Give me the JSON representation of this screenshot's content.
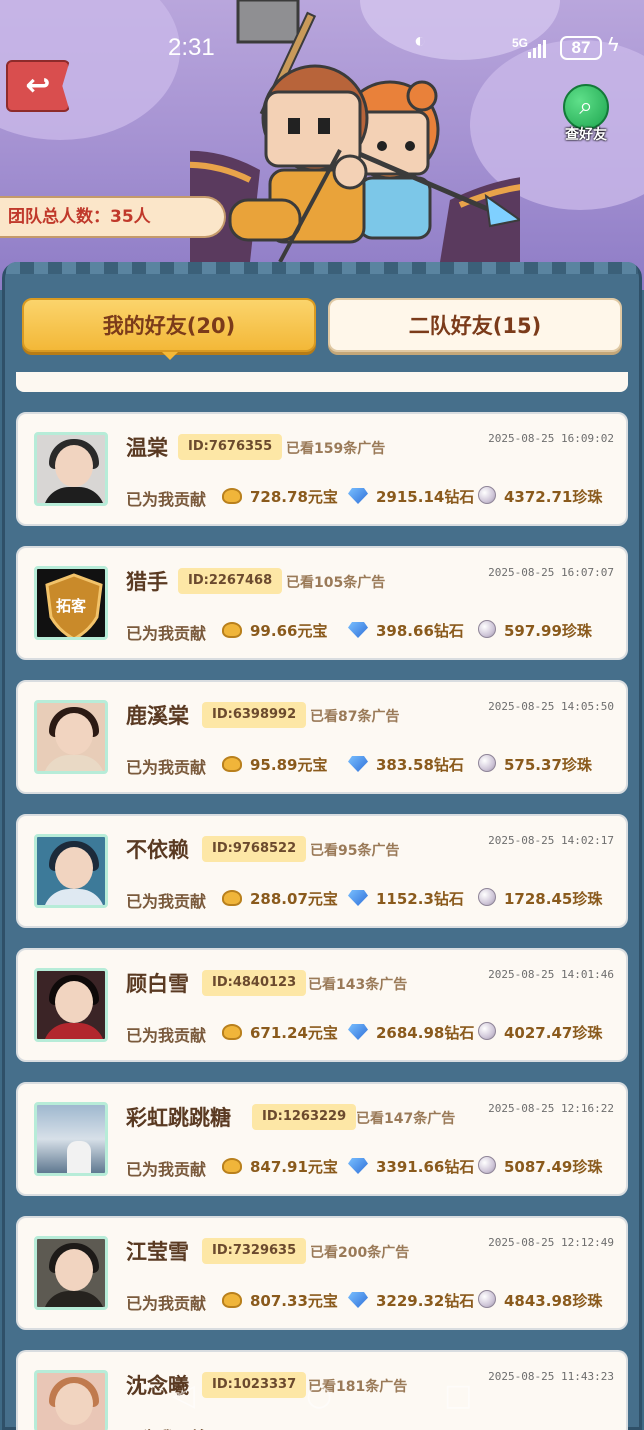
{
  "status_bar": {
    "time": "2:31",
    "network": "5G",
    "battery": "87"
  },
  "header": {
    "back_label": "↩",
    "search_friend_label": "查好友",
    "team_total": "团队总人数：35人"
  },
  "tabs": [
    {
      "label": "我的好友(20)",
      "active": true
    },
    {
      "label": "二队好友(15)",
      "active": false
    }
  ],
  "contrib_label": "已为我贡献",
  "friends": [
    {
      "name": "温棠",
      "id": "ID:7676355",
      "ads": "已看159条广告",
      "date": "2025-08-25 16:09:02",
      "ingot": "728.78元宝",
      "diamond": "2915.14钻石",
      "pearl": "4372.71珍珠"
    },
    {
      "name": "猎手",
      "id": "ID:2267468",
      "ads": "已看105条广告",
      "date": "2025-08-25 16:07:07",
      "ingot": "99.66元宝",
      "diamond": "398.66钻石",
      "pearl": "597.99珍珠",
      "avatar_text": "拓客"
    },
    {
      "name": "鹿溪棠",
      "id": "ID:6398992",
      "ads": "已看87条广告",
      "date": "2025-08-25 14:05:50",
      "ingot": "95.89元宝",
      "diamond": "383.58钻石",
      "pearl": "575.37珍珠"
    },
    {
      "name": "不依赖",
      "id": "ID:9768522",
      "ads": "已看95条广告",
      "date": "2025-08-25 14:02:17",
      "ingot": "288.07元宝",
      "diamond": "1152.3钻石",
      "pearl": "1728.45珍珠"
    },
    {
      "name": "顾白雪",
      "id": "ID:4840123",
      "ads": "已看143条广告",
      "date": "2025-08-25 14:01:46",
      "ingot": "671.24元宝",
      "diamond": "2684.98钻石",
      "pearl": "4027.47珍珠"
    },
    {
      "name": "彩虹跳跳糖",
      "id": "ID:1263229",
      "ads": "已看147条广告",
      "date": "2025-08-25 12:16:22",
      "ingot": "847.91元宝",
      "diamond": "3391.66钻石",
      "pearl": "5087.49珍珠"
    },
    {
      "name": "江莹雪",
      "id": "ID:7329635",
      "ads": "已看200条广告",
      "date": "2025-08-25 12:12:49",
      "ingot": "807.33元宝",
      "diamond": "3229.32钻石",
      "pearl": "4843.98珍珠"
    },
    {
      "name": "沈念曦",
      "id": "ID:1023337",
      "ads": "已看181条广告",
      "date": "2025-08-25 11:43:23",
      "ingot": "",
      "diamond": "",
      "pearl": ""
    }
  ]
}
